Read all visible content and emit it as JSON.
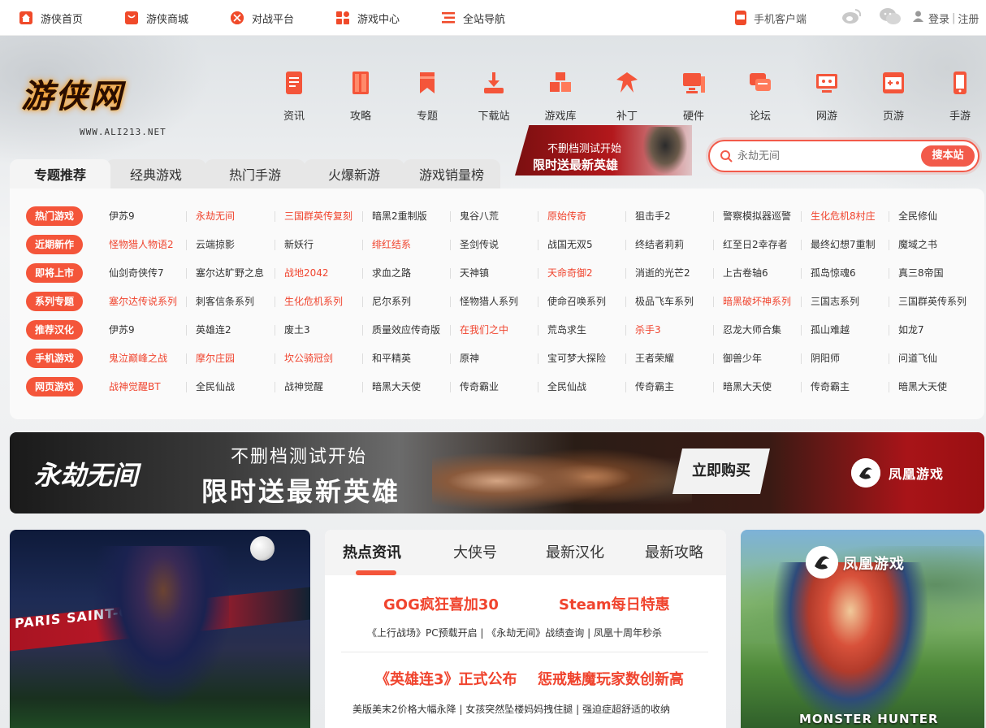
{
  "topbar": {
    "left": [
      {
        "label": "游侠首页",
        "icon": "home-icon"
      },
      {
        "label": "游侠商城",
        "icon": "shop-bag-icon"
      },
      {
        "label": "对战平台",
        "icon": "battle-platform-icon"
      },
      {
        "label": "游戏中心",
        "icon": "game-center-icon"
      },
      {
        "label": "全站导航",
        "icon": "menu-list-icon"
      }
    ],
    "mobile_client": "手机客户端",
    "login": "登录",
    "divider": "|",
    "register": "注册"
  },
  "logo": {
    "text": "游侠网",
    "url": "WWW.ALI213.NET"
  },
  "nav": [
    {
      "label": "资讯",
      "icon": "news-doc-icon"
    },
    {
      "label": "攻略",
      "icon": "guide-book-icon"
    },
    {
      "label": "专题",
      "icon": "bookmark-icon"
    },
    {
      "label": "下载站",
      "icon": "download-icon"
    },
    {
      "label": "游戏库",
      "icon": "cubes-icon"
    },
    {
      "label": "补丁",
      "icon": "patch-pin-icon"
    },
    {
      "label": "硬件",
      "icon": "hardware-monitor-icon"
    },
    {
      "label": "论坛",
      "icon": "forum-chat-icon"
    },
    {
      "label": "网游",
      "icon": "online-game-icon"
    },
    {
      "label": "页游",
      "icon": "web-game-icon"
    },
    {
      "label": "手游",
      "icon": "mobile-game-icon"
    }
  ],
  "promo_small": {
    "line1": "不删档测试开始",
    "line2": "限时送最新英雄"
  },
  "search": {
    "placeholder": "永劫无间",
    "button": "搜本站"
  },
  "tabs": [
    "专题推荐",
    "经典游戏",
    "热门手游",
    "火爆新游",
    "游戏销量榜"
  ],
  "topic_rows": [
    {
      "tag": "热门游戏",
      "items": [
        {
          "t": "伊苏9",
          "hot": false
        },
        {
          "t": "永劫无间",
          "hot": true
        },
        {
          "t": "三国群英传复刻",
          "hot": true
        },
        {
          "t": "暗黑2重制版",
          "hot": false
        },
        {
          "t": "鬼谷八荒",
          "hot": false
        },
        {
          "t": "原始传奇",
          "hot": true
        },
        {
          "t": "狙击手2",
          "hot": false
        },
        {
          "t": "警察模拟器巡警",
          "hot": false
        },
        {
          "t": "生化危机8村庄",
          "hot": true
        },
        {
          "t": "全民修仙",
          "hot": false
        }
      ]
    },
    {
      "tag": "近期新作",
      "items": [
        {
          "t": "怪物猎人物语2",
          "hot": true
        },
        {
          "t": "云端掠影",
          "hot": false
        },
        {
          "t": "新妖行",
          "hot": false
        },
        {
          "t": "绯红结系",
          "hot": true
        },
        {
          "t": "圣剑传说",
          "hot": false
        },
        {
          "t": "战国无双5",
          "hot": false
        },
        {
          "t": "终结者莉莉",
          "hot": false
        },
        {
          "t": "红至日2幸存者",
          "hot": false
        },
        {
          "t": "最终幻想7重制",
          "hot": false
        },
        {
          "t": "魔域之书",
          "hot": false
        }
      ]
    },
    {
      "tag": "即将上市",
      "items": [
        {
          "t": "仙剑奇侠传7",
          "hot": false
        },
        {
          "t": "塞尔达旷野之息",
          "hot": false
        },
        {
          "t": "战地2042",
          "hot": true
        },
        {
          "t": "求血之路",
          "hot": false
        },
        {
          "t": "天神镇",
          "hot": false
        },
        {
          "t": "天命奇御2",
          "hot": true
        },
        {
          "t": "消逝的光芒2",
          "hot": false
        },
        {
          "t": "上古卷轴6",
          "hot": false
        },
        {
          "t": "孤岛惊魂6",
          "hot": false
        },
        {
          "t": "真三8帝国",
          "hot": false
        }
      ]
    },
    {
      "tag": "系列专题",
      "items": [
        {
          "t": "塞尔达传说系列",
          "hot": true
        },
        {
          "t": "刺客信条系列",
          "hot": false
        },
        {
          "t": "生化危机系列",
          "hot": true
        },
        {
          "t": "尼尔系列",
          "hot": false
        },
        {
          "t": "怪物猎人系列",
          "hot": false
        },
        {
          "t": "使命召唤系列",
          "hot": false
        },
        {
          "t": "极品飞车系列",
          "hot": false
        },
        {
          "t": "暗黑破坏神系列",
          "hot": true
        },
        {
          "t": "三国志系列",
          "hot": false
        },
        {
          "t": "三国群英传系列",
          "hot": false
        }
      ]
    },
    {
      "tag": "推荐汉化",
      "items": [
        {
          "t": "伊苏9",
          "hot": false
        },
        {
          "t": "英雄连2",
          "hot": false
        },
        {
          "t": "废土3",
          "hot": false
        },
        {
          "t": "质量效应传奇版",
          "hot": false
        },
        {
          "t": "在我们之中",
          "hot": true
        },
        {
          "t": "荒岛求生",
          "hot": false
        },
        {
          "t": "杀手3",
          "hot": true
        },
        {
          "t": "忍龙大师合集",
          "hot": false
        },
        {
          "t": "孤山难越",
          "hot": false
        },
        {
          "t": "如龙7",
          "hot": false
        }
      ]
    },
    {
      "tag": "手机游戏",
      "items": [
        {
          "t": "鬼泣巅峰之战",
          "hot": true
        },
        {
          "t": "摩尔庄园",
          "hot": true
        },
        {
          "t": "坎公骑冠剑",
          "hot": true
        },
        {
          "t": "和平精英",
          "hot": false
        },
        {
          "t": "原神",
          "hot": false
        },
        {
          "t": "宝可梦大探险",
          "hot": false
        },
        {
          "t": "王者荣耀",
          "hot": false
        },
        {
          "t": "御兽少年",
          "hot": false
        },
        {
          "t": "阴阳师",
          "hot": false
        },
        {
          "t": "问道飞仙",
          "hot": false
        }
      ]
    },
    {
      "tag": "网页游戏",
      "items": [
        {
          "t": "战神觉醒BT",
          "hot": true
        },
        {
          "t": "全民仙战",
          "hot": false
        },
        {
          "t": "战神觉醒",
          "hot": false
        },
        {
          "t": "暗黑大天使",
          "hot": false
        },
        {
          "t": "传奇霸业",
          "hot": false
        },
        {
          "t": "全民仙战",
          "hot": false
        },
        {
          "t": "传奇霸主",
          "hot": false
        },
        {
          "t": "暗黑大天使",
          "hot": false
        },
        {
          "t": "传奇霸主",
          "hot": false
        },
        {
          "t": "暗黑大天使",
          "hot": false
        }
      ]
    }
  ],
  "banner": {
    "logo": "永劫无间",
    "line1": "不删档测试开始",
    "line2": "限时送最新英雄",
    "buy": "立即购买",
    "brand": "凤凰游戏"
  },
  "left_image": {
    "stripe": "PARIS SAINT-GE"
  },
  "news": {
    "tabs": [
      "热点资讯",
      "大侠号",
      "最新汉化",
      "最新攻略"
    ],
    "headline1a": "GOG疯狂喜加30",
    "headline1b": "Steam每日特惠",
    "sub1": "《上行战场》PC预载开启 | 《永劫无间》战绩查询 | 凤凰十周年秒杀",
    "headline2a": "《英雄连3》正式公布",
    "headline2b": "惩戒魅魔玩家数创新高",
    "sub2": "美版美末2价格大幅永降 | 女孩突然坠楼妈妈拽住腿 | 强迫症超舒适的收纳"
  },
  "right_image": {
    "brand": "凤凰游戏",
    "title": "MONSTER HUNTER"
  },
  "colors": {
    "accent": "#f4553a",
    "hot_text": "#f0442e"
  }
}
